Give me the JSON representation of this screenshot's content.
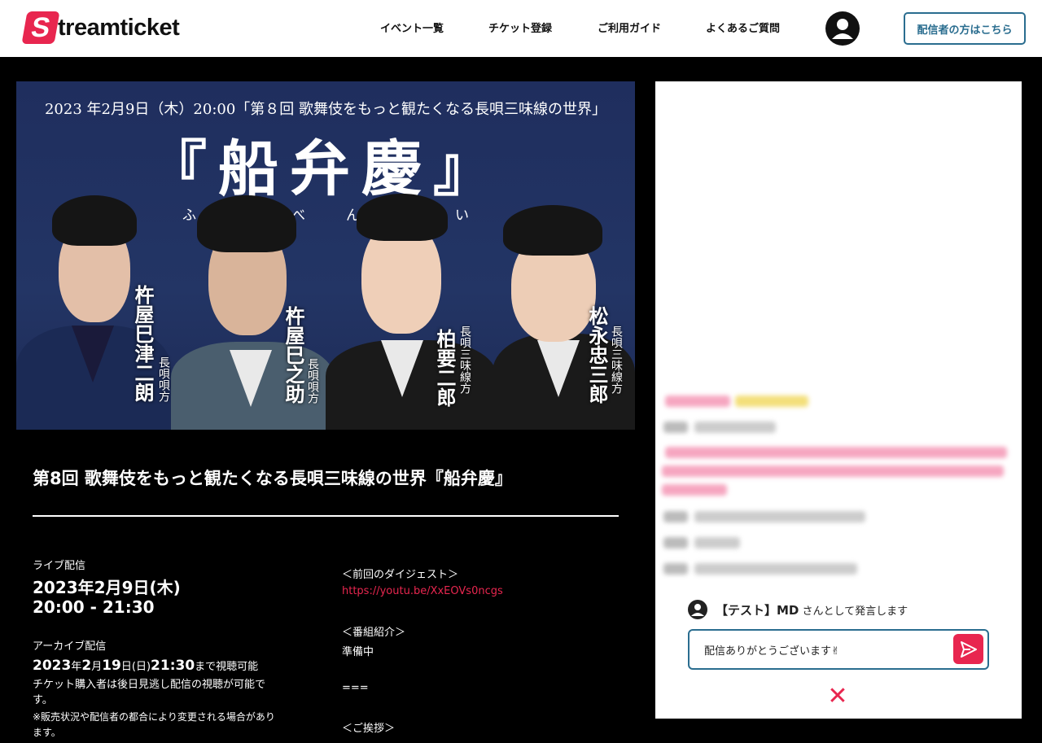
{
  "header": {
    "logo_letter": "S",
    "logo_text": "treamticket",
    "nav": [
      {
        "label": "イベント一覧"
      },
      {
        "label": "チケット登録"
      },
      {
        "label": "ご利用ガイド"
      },
      {
        "label": "よくあるご質問"
      }
    ],
    "publisher_button": "配信者の方はこちら"
  },
  "banner": {
    "top_line": "2023 年2月9日（木）20:00「第８回 歌舞伎をもっと観たくなる長唄三味線の世界」",
    "title": "『船弁慶』",
    "ruby": "ふなべんけい",
    "performers": [
      {
        "name": "杵屋巳津二朗",
        "role": "長唄唄方"
      },
      {
        "name": "杵屋巳之助",
        "role": "長唄唄方"
      },
      {
        "name": "柏要二郎",
        "role": "長唄三味線方"
      },
      {
        "name": "松永忠三郎",
        "role": "長唄三味線方"
      }
    ]
  },
  "event": {
    "title": "第8回 歌舞伎をもっと観たくなる長唄三味線の世界『船弁慶』",
    "live_label": "ライブ配信",
    "live_date": "2023年2月9日(木)",
    "live_time": "20:00 - 21:30",
    "archive_label": "アーカイブ配信",
    "archive_y": "2023",
    "archive_y_unit": "年",
    "archive_m": "2",
    "archive_m_unit": "月",
    "archive_d": "19",
    "archive_d_unit": "日(日)",
    "archive_t": "21:30",
    "archive_suffix": "まで視聴可能",
    "archive_note_1": "チケット購入者は後日見逃し配信の視聴が可能で",
    "archive_note_2": "す。",
    "archive_note_3": "※販売状況や配信者の都合により変更される場合があり",
    "archive_note_4": "ます。",
    "digest_heading": "＜前回のダイジェスト＞",
    "digest_link": "https://youtu.be/XxEOVs0ncgs",
    "program_heading": "＜番組紹介＞",
    "program_text": "準備中",
    "separator": "===",
    "greeting_heading": "＜ご挨拶＞"
  },
  "chat": {
    "user_name": "【テスト】MD",
    "speak_as": " さんとして発言します",
    "input_value": "配信ありがとうございます✌",
    "colors": {
      "accent": "#e8264f",
      "border": "#2a6d8f"
    }
  }
}
